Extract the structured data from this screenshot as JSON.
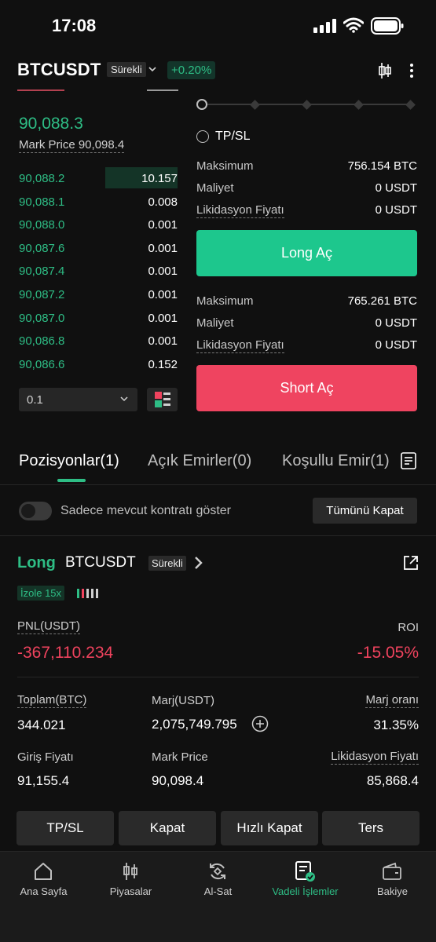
{
  "status_bar": {
    "time": "17:08"
  },
  "header": {
    "symbol": "BTCUSDT",
    "contract_type": "Sürekli",
    "change": "+0.20%"
  },
  "order_book": {
    "last_price": "90,088.3",
    "mark_price_text": "Mark Price 90,098.4",
    "bids": [
      {
        "price": "90,088.2",
        "qty": "10.157",
        "depth": 0.44
      },
      {
        "price": "90,088.1",
        "qty": "0.008",
        "depth": 0
      },
      {
        "price": "90,088.0",
        "qty": "0.001",
        "depth": 0
      },
      {
        "price": "90,087.6",
        "qty": "0.001",
        "depth": 0
      },
      {
        "price": "90,087.4",
        "qty": "0.001",
        "depth": 0
      },
      {
        "price": "90,087.2",
        "qty": "0.001",
        "depth": 0
      },
      {
        "price": "90,087.0",
        "qty": "0.001",
        "depth": 0
      },
      {
        "price": "90,086.8",
        "qty": "0.001",
        "depth": 0
      },
      {
        "price": "90,086.6",
        "qty": "0.152",
        "depth": 0
      }
    ],
    "precision": "0.1"
  },
  "trade_panel": {
    "tpsl_label": "TP/SL",
    "long": {
      "max_label": "Maksimum",
      "max_value": "756.154 BTC",
      "cost_label": "Maliyet",
      "cost_value": "0 USDT",
      "liq_label": "Likidasyon Fiyatı",
      "liq_value": "0 USDT",
      "button": "Long Aç"
    },
    "short": {
      "max_label": "Maksimum",
      "max_value": "765.261 BTC",
      "cost_label": "Maliyet",
      "cost_value": "0 USDT",
      "liq_label": "Likidasyon Fiyatı",
      "liq_value": "0 USDT",
      "button": "Short Aç"
    }
  },
  "tabs": [
    {
      "label": "Pozisyonlar(1)",
      "active": true
    },
    {
      "label": "Açık Emirler(0)",
      "active": false
    },
    {
      "label": "Koşullu Emir(1)",
      "active": false
    }
  ],
  "filter": {
    "toggle_label": "Sadece mevcut kontratı göster",
    "close_all": "Tümünü Kapat"
  },
  "position": {
    "side": "Long",
    "symbol": "BTCUSDT",
    "contract_type": "Sürekli",
    "margin_mode": "İzole 15x",
    "pnl_label": "PNL(USDT)",
    "pnl_value": "-367,110.234",
    "roi_label": "ROI",
    "roi_value": "-15.05%",
    "total_label": "Toplam(BTC)",
    "total_value": "344.021",
    "margin_label": "Marj(USDT)",
    "margin_value": "2,075,749.795",
    "margin_ratio_label": "Marj oranı",
    "margin_ratio_value": "31.35%",
    "entry_label": "Giriş Fiyatı",
    "entry_value": "91,155.4",
    "mark_label": "Mark Price",
    "mark_value": "90,098.4",
    "liq_label": "Likidasyon Fiyatı",
    "liq_value": "85,868.4",
    "actions": [
      "TP/SL",
      "Kapat",
      "Hızlı Kapat",
      "Ters"
    ]
  },
  "bottom_nav": [
    {
      "label": "Ana Sayfa",
      "icon": "home-icon",
      "active": false
    },
    {
      "label": "Piyasalar",
      "icon": "candlestick-icon",
      "active": false
    },
    {
      "label": "Al-Sat",
      "icon": "exchange-icon",
      "active": false
    },
    {
      "label": "Vadeli İşlemler",
      "icon": "futures-icon",
      "active": true
    },
    {
      "label": "Bakiye",
      "icon": "wallet-icon",
      "active": false
    }
  ],
  "colors": {
    "accent_green": "#2ebd85",
    "accent_red": "#f0435e",
    "button_green": "#1dc78d",
    "background": "#101010"
  }
}
